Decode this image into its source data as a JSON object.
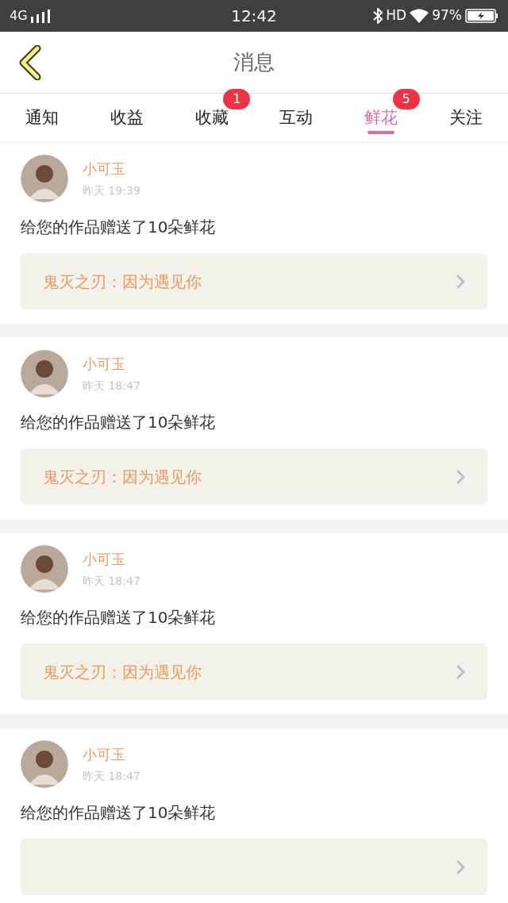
{
  "status_bar": {
    "network": "4G",
    "time": "12:42",
    "hd": "HD",
    "battery": "97%"
  },
  "header": {
    "title": "消息"
  },
  "tabs": [
    {
      "label": "通知",
      "selected": false
    },
    {
      "label": "收益",
      "selected": false
    },
    {
      "label": "收藏",
      "selected": false,
      "badge": "1"
    },
    {
      "label": "互动",
      "selected": false
    },
    {
      "label": "鲜花",
      "selected": true,
      "badge": "5"
    },
    {
      "label": "关注",
      "selected": false
    }
  ],
  "messages": [
    {
      "name": "小可玉",
      "time": "昨天 19:39",
      "text": "给您的作品赠送了10朵鲜花",
      "link": "鬼灭之刃：因为遇见你"
    },
    {
      "name": "小可玉",
      "time": "昨天 18:47",
      "text": "给您的作品赠送了10朵鲜花",
      "link": "鬼灭之刃：因为遇见你"
    },
    {
      "name": "小可玉",
      "time": "昨天 18:47",
      "text": "给您的作品赠送了10朵鲜花",
      "link": "鬼灭之刃：因为遇见你"
    },
    {
      "name": "小可玉",
      "time": "昨天 18:47",
      "text": "给您的作品赠送了10朵鲜花"
    }
  ]
}
